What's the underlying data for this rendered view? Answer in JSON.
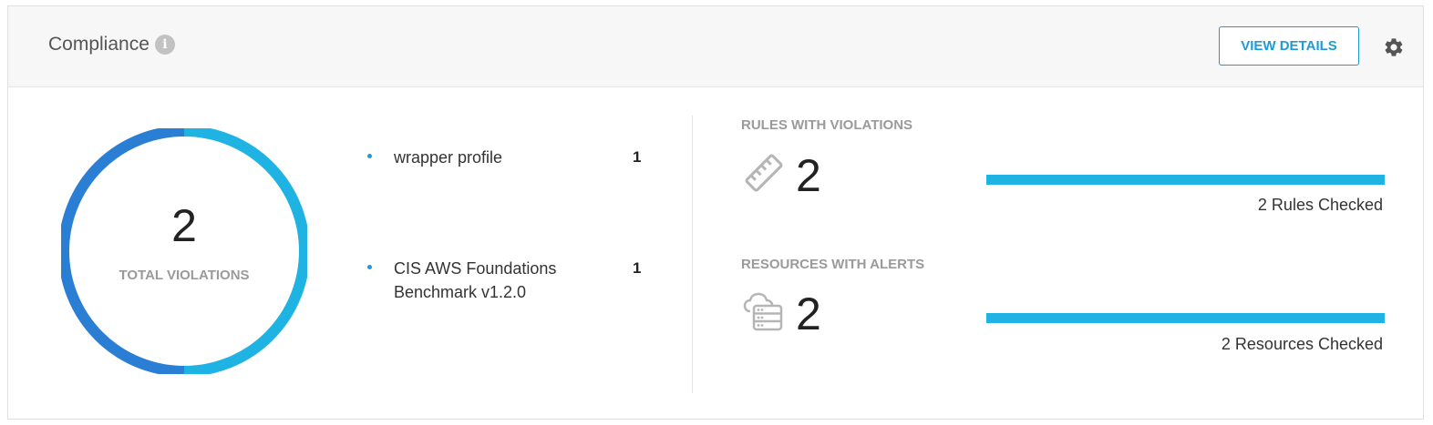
{
  "header": {
    "title": "Compliance",
    "info_icon_glyph": "i",
    "view_details_label": "VIEW DETAILS",
    "icons": [
      "info-icon",
      "gear-icon"
    ]
  },
  "violations": {
    "total": "2",
    "label": "TOTAL VIOLATIONS",
    "segments": [
      {
        "name": "wrapper profile",
        "value": 1,
        "color": "#1fb3e3"
      },
      {
        "name": "CIS AWS Foundations Benchmark v1.2.0",
        "value": 1,
        "color": "#2a7fd4"
      }
    ]
  },
  "profiles": [
    {
      "name": "wrapper profile",
      "count": "1"
    },
    {
      "name": "CIS AWS Foundations Benchmark v1.2.0",
      "count": "1"
    }
  ],
  "rules": {
    "label": "RULES WITH VIOLATIONS",
    "value": "2",
    "checked_text": "2 Rules Checked",
    "bar_fill_fraction": 1.0,
    "icon": "ruler-icon"
  },
  "resources": {
    "label": "RESOURCES WITH ALERTS",
    "value": "2",
    "checked_text": "2 Resources Checked",
    "bar_fill_fraction": 1.0,
    "icon": "cloud-server-icon"
  },
  "colors": {
    "accent": "#1e9bd7",
    "bar": "#1fb3e3",
    "donut_dark": "#2a7fd4",
    "donut_light": "#1fb3e3"
  }
}
